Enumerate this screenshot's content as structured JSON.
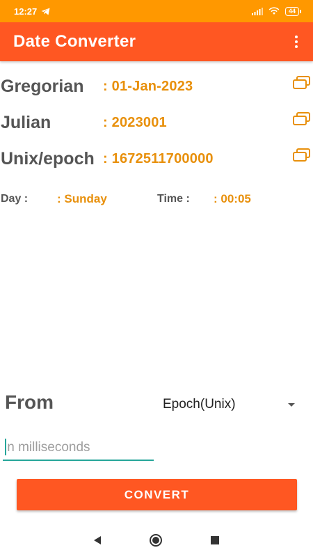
{
  "status_bar": {
    "time": "12:27",
    "battery": "44",
    "icons": [
      "telegram-icon",
      "signal-icon",
      "wifi-icon",
      "battery-icon"
    ]
  },
  "app_bar": {
    "title": "Date Converter",
    "menu_icon": "overflow-menu-icon"
  },
  "results": {
    "gregorian": {
      "label": "Gregorian",
      "value": ": 01-Jan-2023"
    },
    "julian": {
      "label": "Julian",
      "value": ": 2023001"
    },
    "unix": {
      "label": "Unix/epoch",
      "value": ": 1672511700000"
    },
    "day": {
      "label": "Day :",
      "value": ": Sunday"
    },
    "time": {
      "label": "Time :",
      "value": ": 00:05"
    }
  },
  "form": {
    "from_label": "From",
    "from_selected": "Epoch(Unix)",
    "input_value": "",
    "input_placeholder": "in milliseconds",
    "convert_label": "CONVERT"
  },
  "colors": {
    "status_bar": "#ff9800",
    "app_bar": "#ff5722",
    "value_text": "#e8900c",
    "label_text": "#555555",
    "input_underline": "#26a69a"
  },
  "nav": {
    "icons": [
      "back-icon",
      "home-icon",
      "recents-icon"
    ]
  }
}
